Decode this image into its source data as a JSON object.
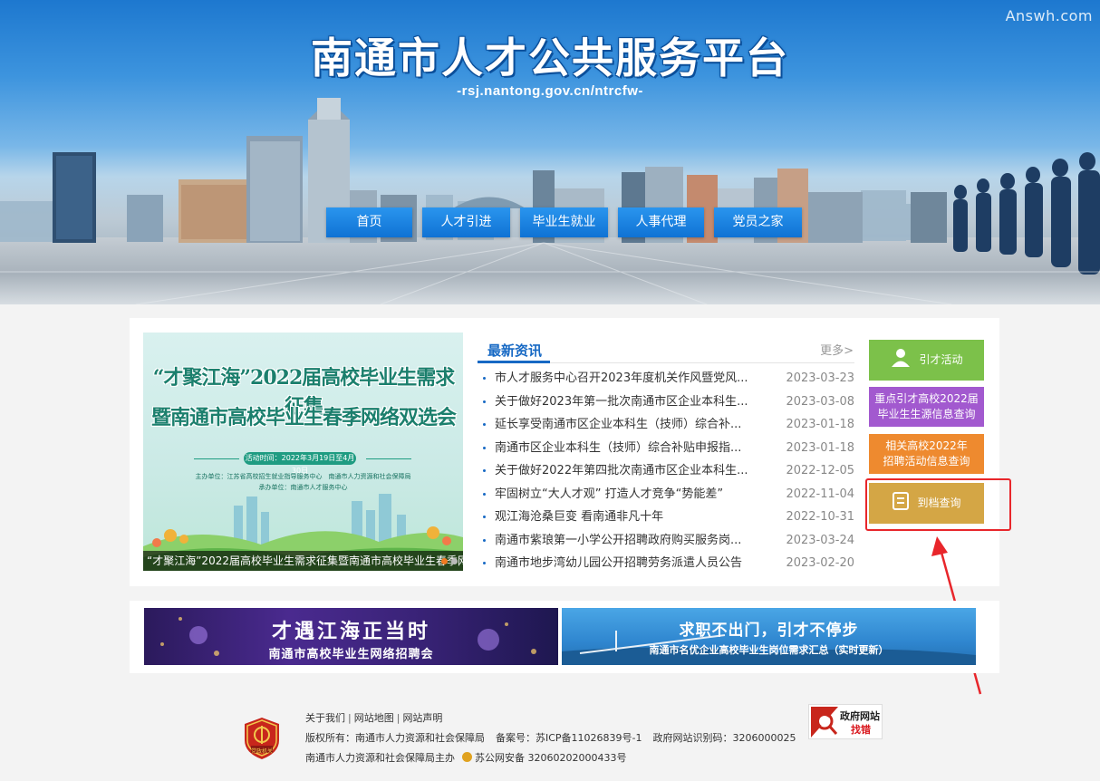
{
  "watermark": "Answh.com",
  "header": {
    "title": "南通市人才公共服务平台",
    "url": "-rsj.nantong.gov.cn/ntrcfw-"
  },
  "nav": {
    "items": [
      {
        "label": "首页"
      },
      {
        "label": "人才引进"
      },
      {
        "label": "毕业生就业"
      },
      {
        "label": "人事代理"
      },
      {
        "label": "党员之家"
      }
    ]
  },
  "feature": {
    "line1": "“才聚江海”2022届高校毕业生需求征集",
    "line2": "暨南通市高校毕业生春季网络双选会",
    "date": "活动时间：2022年3月19日至4月30日",
    "org1": "主办单位：江苏省高校招生就业指导服务中心　南通市人力资源和社会保障局",
    "org2": "承办单位：南通市人才服务中心",
    "caption": "“才聚江海”2022届高校毕业生需求征集暨南通市高校毕业生春季网络..."
  },
  "news": {
    "tab": "最新资讯",
    "more": "更多>",
    "items": [
      {
        "title": "市人才服务中心召开2023年度机关作风暨党风...",
        "date": "2023-03-23"
      },
      {
        "title": "关于做好2023年第一批次南通市区企业本科生...",
        "date": "2023-03-08"
      },
      {
        "title": "延长享受南通市区企业本科生（技师）综合补...",
        "date": "2023-01-18"
      },
      {
        "title": "南通市区企业本科生（技师）综合补贴申报指...",
        "date": "2023-01-18"
      },
      {
        "title": "关于做好2022年第四批次南通市区企业本科生...",
        "date": "2022-12-05"
      },
      {
        "title": "牢固树立“大人才观” 打造人才竞争“势能差”",
        "date": "2022-11-04"
      },
      {
        "title": "观江海沧桑巨变 看南通非凡十年",
        "date": "2022-10-31"
      },
      {
        "title": "南通市紫琅第一小学公开招聘政府购买服务岗...",
        "date": "2023-03-24"
      },
      {
        "title": "南通市地步湾幼儿园公开招聘劳务派遣人员公告",
        "date": "2023-02-20"
      }
    ]
  },
  "quick": {
    "talent_activity": "引才活动",
    "key_colleges_1": "重点引才高校2022届",
    "key_colleges_2": "毕业生生源信息查询",
    "related_colleges_1": "相关高校2022年",
    "related_colleges_2": "招聘活动信息查询",
    "archive_query": "到档查询"
  },
  "ads": {
    "ad1_line1": "才遇江海正当时",
    "ad1_line2": "南通市高校毕业生网络招聘会",
    "ad2_line1": "求职不出门，引才不停步",
    "ad2_line2": "南通市名优企业高校毕业生岗位需求汇总（实时更新）"
  },
  "footer": {
    "about": "关于我们",
    "sitemap": "网站地图",
    "statement": "网站声明",
    "copyright": "版权所有：南通市人力资源和社会保障局",
    "icp": "备案号：苏ICP备11026839号-1",
    "gov_id": "政府网站识别码：3206000025",
    "host": "南通市人力资源和社会保障局主办",
    "police": "苏公网安备 32060202000433号",
    "emblem_text": "党政机关",
    "gov_badge_line1": "政府网站",
    "gov_badge_line2": "找错"
  },
  "colors": {
    "nav_blue": "#1a80e0",
    "news_blue": "#1769c4",
    "green_button": "#7cc14a",
    "purple_button": "#a259cf",
    "orange_button": "#ee8a2f",
    "gold_button": "#d4a645",
    "callout_red": "#e8262b"
  }
}
